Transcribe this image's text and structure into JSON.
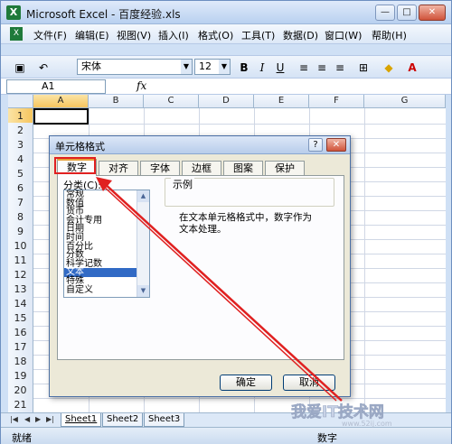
{
  "window": {
    "title": "Microsoft Excel - 百度经验.xls",
    "app_icon": "X",
    "controls": {
      "minimize": "—",
      "maximize": "□",
      "close": "✕"
    }
  },
  "menu": {
    "items": [
      "文件(F)",
      "编辑(E)",
      "视图(V)",
      "插入(I)",
      "格式(O)",
      "工具(T)",
      "数据(D)",
      "窗口(W)",
      "帮助(H)"
    ]
  },
  "toolbar": {
    "font_name": "宋体",
    "font_size": "12",
    "bold": "B",
    "italic": "I",
    "underline": "U",
    "font_color_label": "A"
  },
  "formula_bar": {
    "name_box": "A1",
    "fx_label": "fx"
  },
  "grid": {
    "columns": [
      "A",
      "B",
      "C",
      "D",
      "E",
      "F",
      "G"
    ],
    "rows": [
      "1",
      "2",
      "3",
      "4",
      "5",
      "6",
      "7",
      "8",
      "9",
      "10",
      "11",
      "12",
      "13",
      "14",
      "15",
      "16",
      "17",
      "18",
      "19",
      "20",
      "21"
    ],
    "selected_column": "A",
    "selected_row": "1"
  },
  "sheets": {
    "tabs": [
      "Sheet1",
      "Sheet2",
      "Sheet3"
    ],
    "active": "Sheet1"
  },
  "status": {
    "left": "就绪",
    "right": "数字"
  },
  "dialog": {
    "title": "单元格格式",
    "help": "?",
    "close": "✕",
    "tabs": [
      "数字",
      "对齐",
      "字体",
      "边框",
      "图案",
      "保护"
    ],
    "active_tab": "数字",
    "category_label": "分类(C):",
    "categories": [
      "常规",
      "数值",
      "货币",
      "会计专用",
      "日期",
      "时间",
      "百分比",
      "分数",
      "科学记数",
      "文本",
      "特殊",
      "自定义"
    ],
    "selected_category": "文本",
    "sample_label": "示例",
    "description": "在文本单元格格式中，数字作为文本处理。",
    "ok": "确定",
    "cancel": "取消"
  },
  "annotation": {
    "color": "#e02020"
  },
  "watermark": {
    "text": "我爱IT技术网",
    "url": "www.52ij.com"
  },
  "colors": {
    "accent": "#316ac5",
    "selected_header": "#f6c55e",
    "annotation": "#e02020"
  }
}
